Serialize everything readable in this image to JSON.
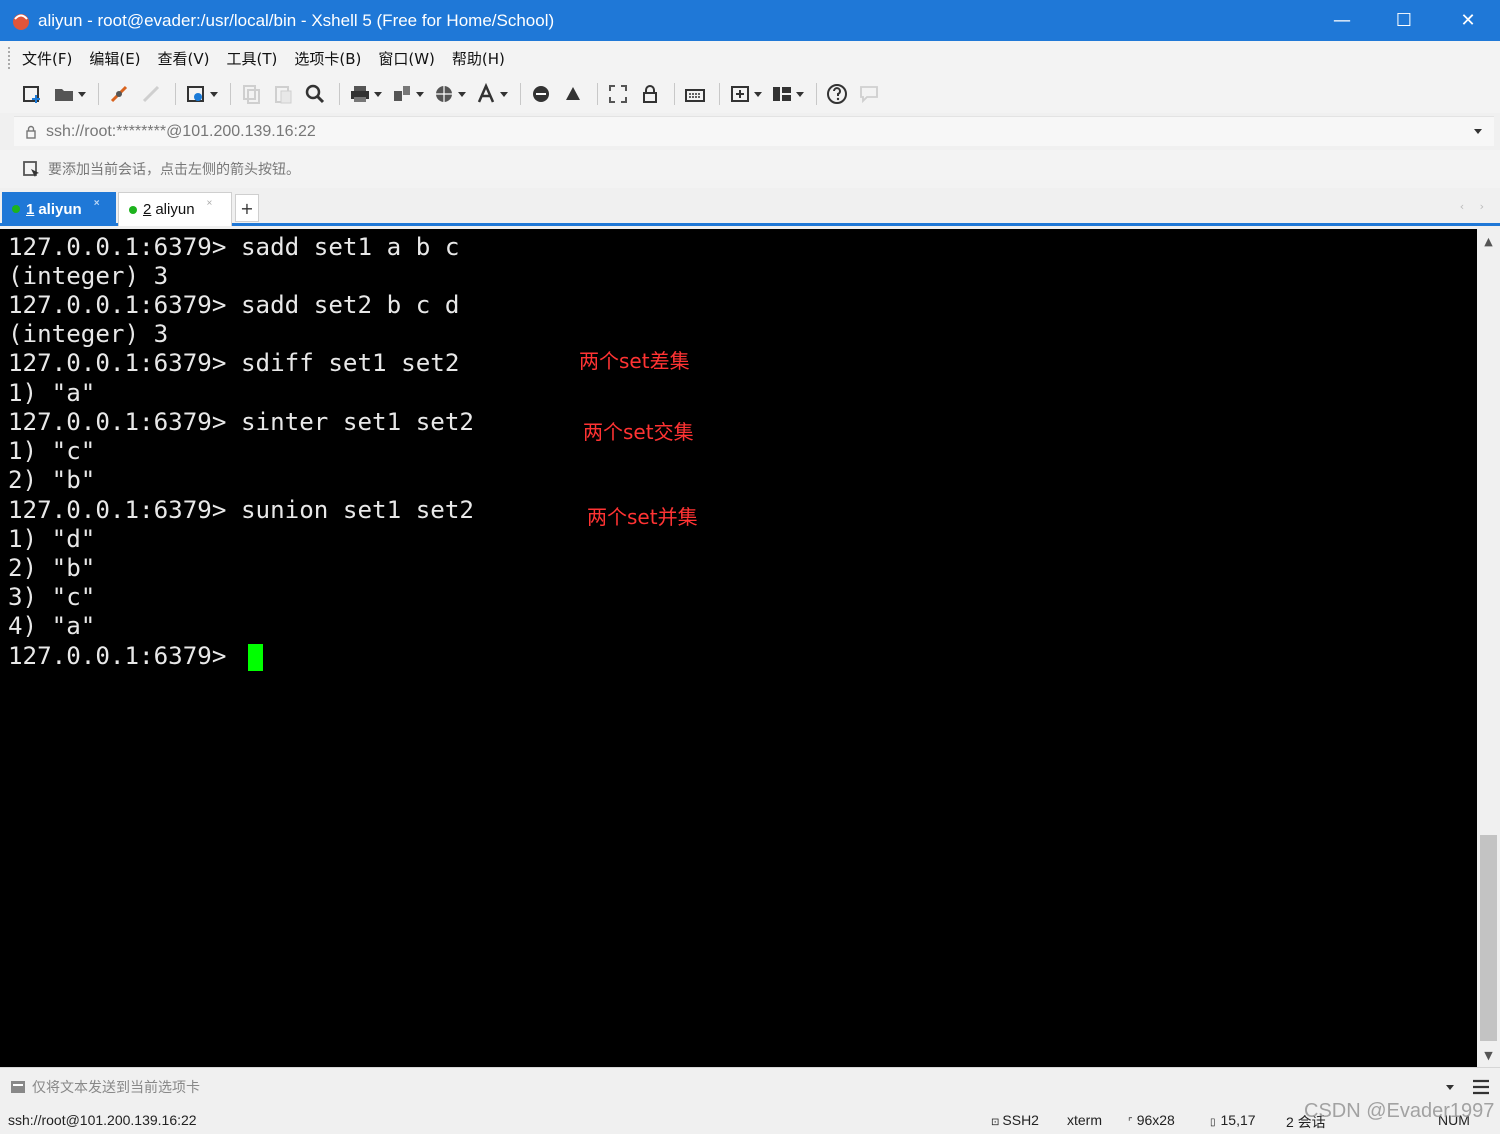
{
  "window": {
    "title": "aliyun - root@evader:/usr/local/bin - Xshell 5 (Free for Home/School)",
    "minimize": "—",
    "maximize": "☐",
    "close": "✕"
  },
  "menu": [
    "文件(F)",
    "编辑(E)",
    "查看(V)",
    "工具(T)",
    "选项卡(B)",
    "窗口(W)",
    "帮助(H)"
  ],
  "address": "ssh://root:********@101.200.139.16:22",
  "hint": "要添加当前会话，点击左侧的箭头按钮。",
  "tabs": [
    {
      "num": "1",
      "label": "aliyun"
    },
    {
      "num": "2",
      "label": "aliyun"
    }
  ],
  "tab_close": "×",
  "tab_add": "+",
  "tab_nav": "‹ ›",
  "terminal": {
    "lines": [
      "127.0.0.1:6379> sadd set1 a b c",
      "(integer) 3",
      "127.0.0.1:6379> sadd set2 b c d",
      "(integer) 3",
      "127.0.0.1:6379> sdiff set1 set2",
      "1) \"a\"",
      "127.0.0.1:6379> sinter set1 set2",
      "1) \"c\"",
      "2) \"b\"",
      "127.0.0.1:6379> sunion set1 set2",
      "1) \"d\"",
      "2) \"b\"",
      "3) \"c\"",
      "4) \"a\"",
      "127.0.0.1:6379> "
    ],
    "annotations": [
      "两个set差集",
      "两个set交集",
      "两个set并集"
    ],
    "annotation_color": "#ff3333",
    "cursor_color": "#00ff00"
  },
  "scroll": {
    "up": "▲",
    "down": "▼"
  },
  "sendbar": {
    "text": "仅将文本发送到当前选项卡"
  },
  "status": {
    "address": "ssh://root@101.200.139.16:22",
    "protocol": "SSH2",
    "term": "xterm",
    "size": "96x28",
    "cursor_pos": "15,17",
    "sessions": "2 会话",
    "num": "NUM"
  },
  "watermark": "CSDN @Evader1997",
  "colors": {
    "accent": "#1f78d7",
    "session_dot": "#1db31d"
  }
}
